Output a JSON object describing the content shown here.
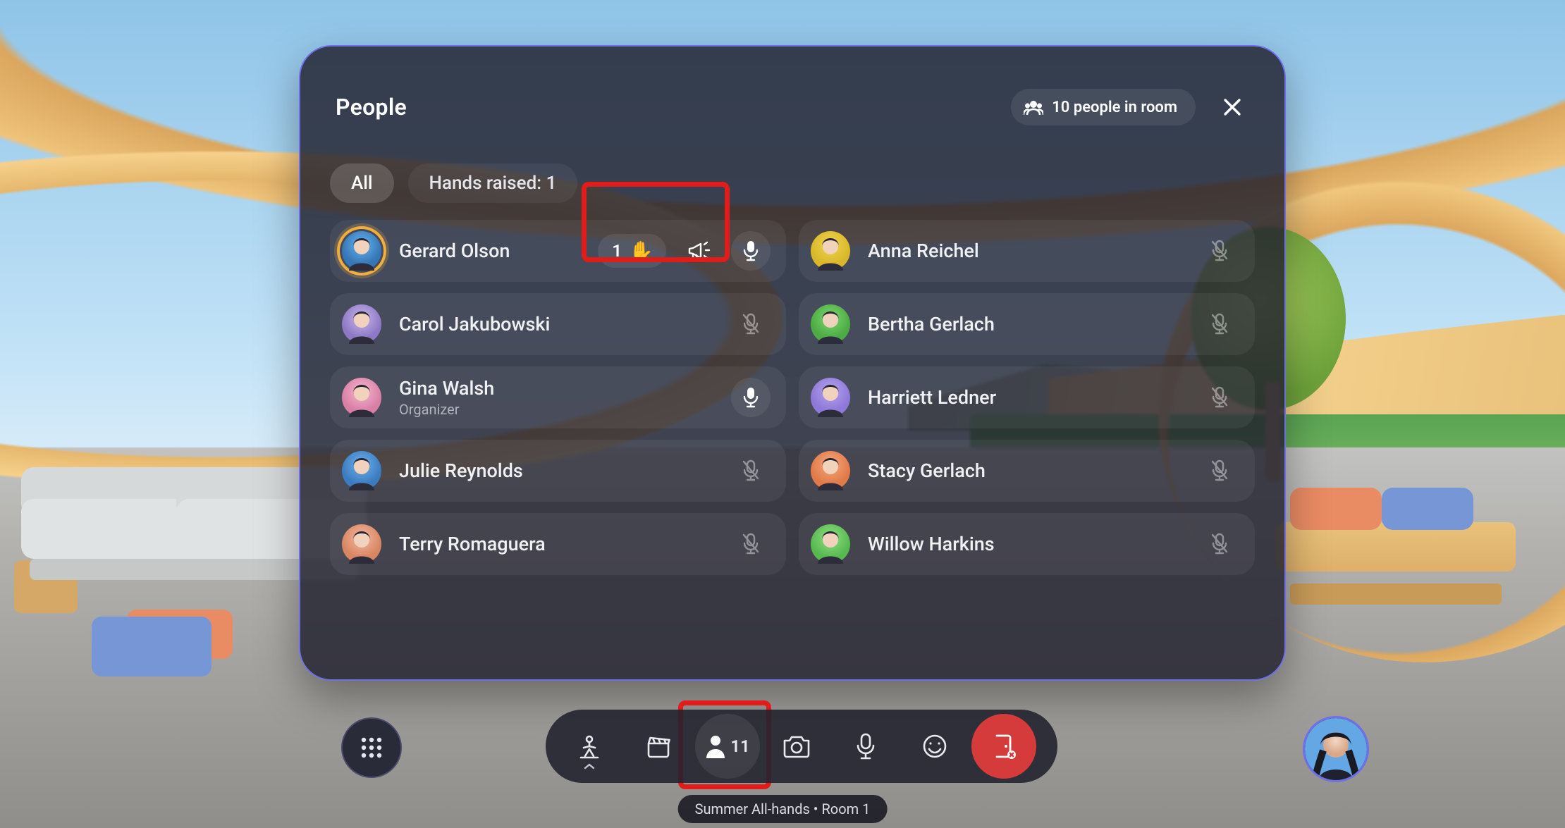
{
  "panel": {
    "title": "People",
    "room_count_label": "10 people in room",
    "tabs": {
      "all": "All",
      "hands_raised": "Hands raised: 1"
    },
    "active_tab": "all"
  },
  "participants": {
    "left": [
      {
        "name": "Gerard Olson",
        "subtitle": "",
        "mic": "active",
        "hand": {
          "order": "1"
        },
        "megaphone": true,
        "avatar_ring": true,
        "avatar_bg1": "#6ab3ef",
        "avatar_bg2": "#3576b5"
      },
      {
        "name": "Carol Jakubowski",
        "subtitle": "",
        "mic": "muted",
        "avatar_bg1": "#c7b7e9",
        "avatar_bg2": "#8e78c6"
      },
      {
        "name": "Gina Walsh",
        "subtitle": "Organizer",
        "mic": "active",
        "avatar_bg1": "#f3b8cf",
        "avatar_bg2": "#d97fa6"
      },
      {
        "name": "Julie Reynolds",
        "subtitle": "",
        "mic": "muted",
        "avatar_bg1": "#6fb1ea",
        "avatar_bg2": "#3b7cc0"
      },
      {
        "name": "Terry Romaguera",
        "subtitle": "",
        "mic": "muted",
        "avatar_bg1": "#f2b8a2",
        "avatar_bg2": "#d88662"
      }
    ],
    "right": [
      {
        "name": "Anna Reichel",
        "subtitle": "",
        "mic": "muted",
        "avatar_bg1": "#f0d64f",
        "avatar_bg2": "#d9b72a"
      },
      {
        "name": "Bertha Gerlach",
        "subtitle": "",
        "mic": "muted",
        "avatar_bg1": "#7ed972",
        "avatar_bg2": "#4cab44"
      },
      {
        "name": "Harriett Ledner",
        "subtitle": "",
        "mic": "muted",
        "avatar_bg1": "#b5a6f0",
        "avatar_bg2": "#8e78d8"
      },
      {
        "name": "Stacy Gerlach",
        "subtitle": "",
        "mic": "muted",
        "avatar_bg1": "#f6a97f",
        "avatar_bg2": "#e07a48"
      },
      {
        "name": "Willow Harkins",
        "subtitle": "",
        "mic": "muted",
        "avatar_bg1": "#8fe083",
        "avatar_bg2": "#58b850"
      }
    ]
  },
  "dock": {
    "people_count": "11"
  },
  "meeting_label": "Summer All-hands • Room 1",
  "colors": {
    "accent": "#6f6fe8",
    "danger": "#d63b3b",
    "highlight": "#e21b1b"
  }
}
